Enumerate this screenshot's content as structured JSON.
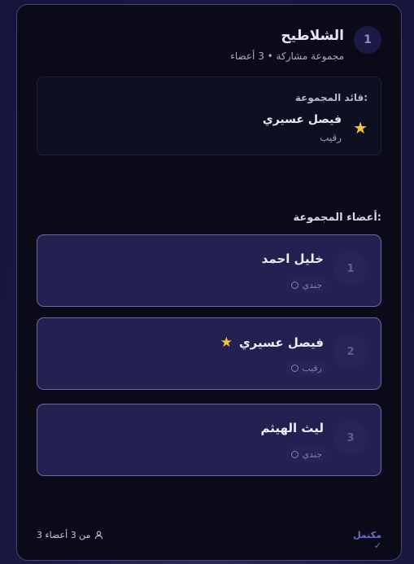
{
  "group": {
    "number": "1",
    "title": "الشلاطيح",
    "subtitle": "مجموعة مشاركة • 3 أعضاء"
  },
  "leader": {
    "heading": ":قائد المجموعة",
    "name": "فيصل عسيري",
    "role": "رقيب",
    "icon": "star-icon"
  },
  "members_heading": ":أعضاء المجموعة",
  "members": [
    {
      "number": "1",
      "name": "خليل احمد",
      "role": "جندي",
      "is_leader": false
    },
    {
      "number": "2",
      "name": "فيصل عسيري",
      "role": "رقيب",
      "is_leader": true
    },
    {
      "number": "3",
      "name": "ليث الهيثم",
      "role": "جندي",
      "is_leader": false
    }
  ],
  "footer": {
    "count_label": "من 3 أعضاء 3",
    "status_label": "مكتمل ✓"
  },
  "colors": {
    "card_bg": "#0a0a18",
    "member_bg": "#232052",
    "star": "#f2c540",
    "status": "#6f6dc0"
  }
}
